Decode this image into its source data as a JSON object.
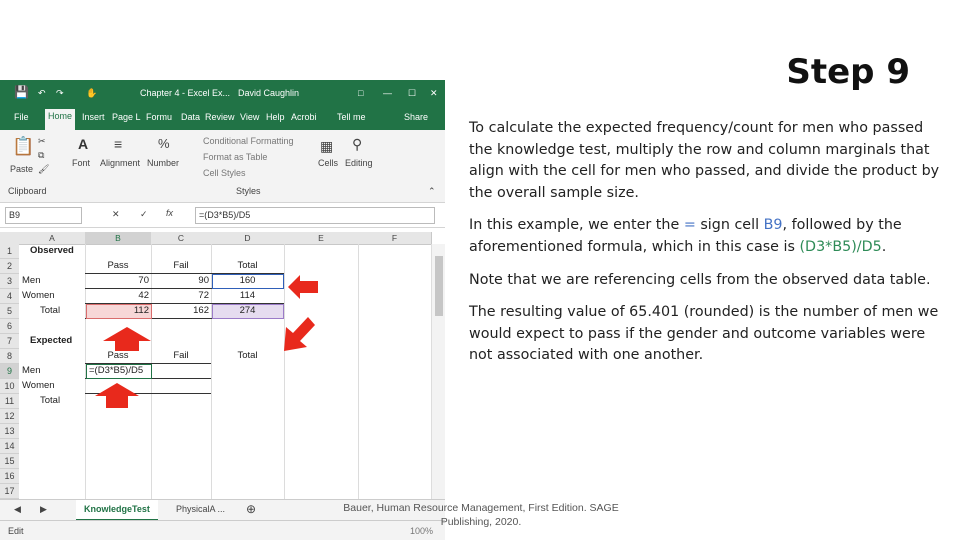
{
  "slide": {
    "title": "Step 9",
    "p1": "To calculate the expected frequency/count for men who passed the knowledge test, multiply the row and column marginals that align with the cell for men who passed, and divide the product by the overall sample size.",
    "p2_a": "In this example, we enter the ",
    "p2_eq": "=",
    "p2_b": " sign cell ",
    "p2_cell": "B9",
    "p2_c": ", followed by the aforementioned formula, which in this case is ",
    "p2_formula": "(D3*B5)/D5",
    "p2_d": ".",
    "p3": "Note that we are referencing cells from the observed data table.",
    "p4": "The resulting value of 65.401 (rounded) is the number of men we would expect to pass if the gender and outcome variables were not associated with one another.",
    "citation_line1": "Bauer, Human Resource Management, First Edition. SAGE",
    "citation_line2": "Publishing, 2020."
  },
  "excel": {
    "window_title": "Chapter 4 - Excel Ex...",
    "user": "David Caughlin",
    "tabs": [
      "File",
      "Home",
      "Insert",
      "Page L",
      "Formu",
      "Data",
      "Review",
      "View",
      "Help",
      "Acrobi",
      "Tell me",
      "Share"
    ],
    "ribbon": {
      "paste": "Paste",
      "font": "Font",
      "alignment": "Alignment",
      "number": "Number",
      "cond_format": "Conditional Formatting",
      "format_table": "Format as Table",
      "cell_styles": "Cell Styles",
      "styles": "Styles",
      "cells": "Cells",
      "editing": "Editing",
      "clipboard": "Clipboard"
    },
    "name_box": "B9",
    "formula": "=(D3*B5)/D5",
    "columns": [
      "A",
      "B",
      "C",
      "D",
      "E",
      "F"
    ],
    "rows": [
      "1",
      "2",
      "3",
      "4",
      "5",
      "6",
      "7",
      "8",
      "9",
      "10",
      "11",
      "12",
      "13",
      "14",
      "15",
      "16",
      "17"
    ],
    "cells": {
      "a1": "Observed",
      "b2": "Pass",
      "c2": "Fail",
      "d2": "Total",
      "a3": "Men",
      "b3": "70",
      "c3": "90",
      "d3": "160",
      "a4": "Women",
      "b4": "42",
      "c4": "72",
      "d4": "114",
      "a5": "Total",
      "b5": "112",
      "c5": "162",
      "d5": "274",
      "a7": "Expected",
      "b8": "Pass",
      "c8": "Fail",
      "d8": "Total",
      "a9": "Men",
      "b9": "=(D3*B5)/D5",
      "a10": "Women",
      "a11": "Total"
    },
    "sheets": [
      "KnowledgeTest",
      "PhysicalA ..."
    ],
    "status": "Edit",
    "zoom": "100%",
    "colors": {
      "excel_green": "#217346",
      "red_arrow": "#e8291c",
      "d3_outline": "#2f5fb8",
      "b5_fill": "#f7d7d7",
      "d5_fill": "#e6dcf0"
    }
  }
}
